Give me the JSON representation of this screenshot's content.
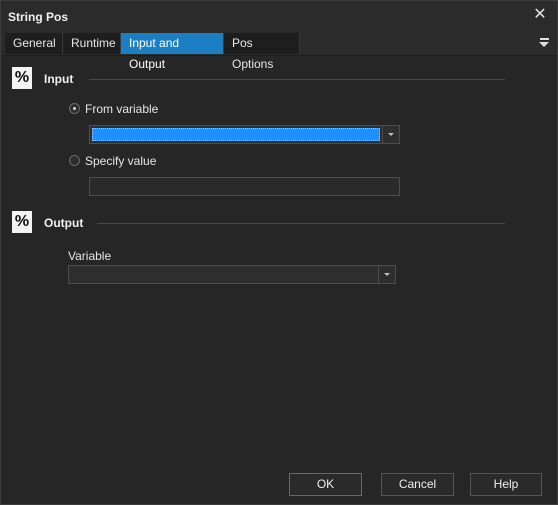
{
  "window": {
    "title": "String Pos"
  },
  "tabs": [
    {
      "label": "General"
    },
    {
      "label": "Runtime"
    },
    {
      "label": "Input and Output"
    },
    {
      "label": "Pos Options"
    }
  ],
  "input_section": {
    "icon": "%",
    "title": "Input",
    "from_variable_label": "From variable",
    "specify_value_label": "Specify value"
  },
  "output_section": {
    "icon": "%",
    "title": "Output",
    "variable_label": "Variable"
  },
  "buttons": {
    "ok": "OK",
    "cancel": "Cancel",
    "help": "Help"
  },
  "colors": {
    "accent": "#1c7fc4",
    "selection": "#1e90ff",
    "background": "#262626"
  }
}
